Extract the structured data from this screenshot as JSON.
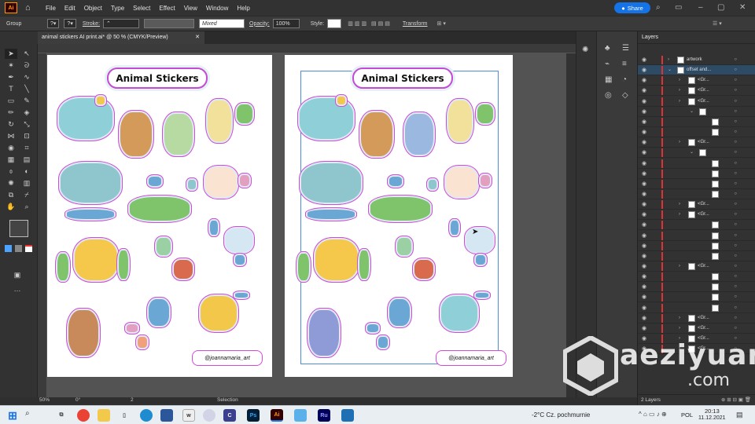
{
  "app": {
    "logo": "Ai",
    "name": "Adobe Illustrator"
  },
  "menu": [
    "File",
    "Edit",
    "Object",
    "Type",
    "Select",
    "Effect",
    "View",
    "Window",
    "Help"
  ],
  "share_label": "Share",
  "control_bar": {
    "selection_type": "Group",
    "stroke_label": "Stroke:",
    "mixed_value": "Mixed",
    "opacity_label": "Opacity:",
    "opacity_value": "100%",
    "style_label": "Style:",
    "transform_label": "Transform"
  },
  "document_tab": {
    "title": "animal stickers AI print.ai* @ 50 % (CMYK/Preview)",
    "close": "✕"
  },
  "artboards": [
    {
      "title": "Animal Stickers",
      "credit": "@joannamaria_art"
    },
    {
      "title": "Animal Stickers",
      "credit": "@joannamaria_art"
    }
  ],
  "layers_panel": {
    "title": "Layers",
    "rows": [
      {
        "name": "artwork",
        "indent": 0,
        "selected": false,
        "expand": "›"
      },
      {
        "name": "offset and...",
        "indent": 0,
        "selected": true,
        "expand": "⌄"
      },
      {
        "name": "<Gr...",
        "indent": 1
      },
      {
        "name": "<Gr...",
        "indent": 1
      },
      {
        "name": "<Gr...",
        "indent": 1
      },
      {
        "name": "",
        "indent": 2
      },
      {
        "name": "",
        "indent": 3
      },
      {
        "name": "",
        "indent": 3
      },
      {
        "name": "<Gr...",
        "indent": 1
      },
      {
        "name": "",
        "indent": 2
      },
      {
        "name": "",
        "indent": 3
      },
      {
        "name": "",
        "indent": 3
      },
      {
        "name": "",
        "indent": 3
      },
      {
        "name": "",
        "indent": 3
      },
      {
        "name": "<Gr...",
        "indent": 1
      },
      {
        "name": "<Gr...",
        "indent": 1
      },
      {
        "name": "",
        "indent": 3
      },
      {
        "name": "",
        "indent": 3
      },
      {
        "name": "",
        "indent": 3
      },
      {
        "name": "",
        "indent": 3
      },
      {
        "name": "<Gr...",
        "indent": 1
      },
      {
        "name": "",
        "indent": 3
      },
      {
        "name": "",
        "indent": 3
      },
      {
        "name": "",
        "indent": 3
      },
      {
        "name": "",
        "indent": 3
      },
      {
        "name": "<Gr...",
        "indent": 1
      },
      {
        "name": "<Gr...",
        "indent": 1
      },
      {
        "name": "<Gr...",
        "indent": 1
      },
      {
        "name": "<Gr...",
        "indent": 1
      }
    ],
    "footer": "2 Layers"
  },
  "status_bar": {
    "zoom": "50%",
    "rotation": "0°",
    "artboard": "2",
    "tool": "Selection"
  },
  "taskbar": {
    "search": "Wpisz tu wyszukiwane słowa",
    "weather": "-2°C  Cz. pochmurnie",
    "lang": "POL",
    "time": "20:13",
    "date": "11.12.2021"
  },
  "watermark": {
    "line1": "aeziyuan",
    "line2": ".com"
  }
}
